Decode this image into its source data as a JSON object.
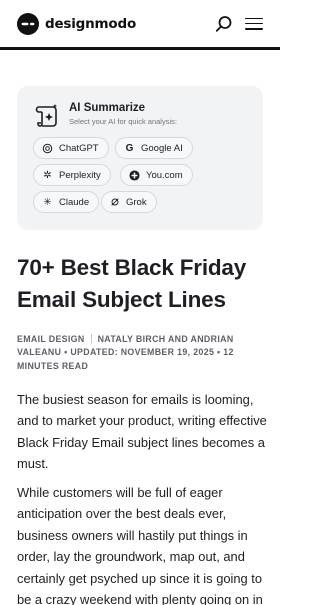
{
  "header": {
    "brand": "designmodo",
    "icons": {
      "logo": "designmodo-logo-icon",
      "search": "search-icon",
      "menu": "hamburger-menu-icon"
    }
  },
  "ai_summarize": {
    "title": "AI Summarize",
    "subtitle": "Select your AI for quick analysis:",
    "icon": "scroll-sparkle-icon",
    "options": [
      {
        "label": "ChatGPT",
        "icon": "chatgpt-icon"
      },
      {
        "label": "Google AI",
        "icon": "google-icon"
      },
      {
        "label": "Perplexity",
        "icon": "perplexity-icon"
      },
      {
        "label": "You.com",
        "icon": "you-com-icon"
      },
      {
        "label": "Claude",
        "icon": "claude-icon"
      },
      {
        "label": "Grok",
        "icon": "grok-icon"
      }
    ]
  },
  "article": {
    "title": "70+ Best Black Friday Email Subject Lines",
    "category": "Email Design",
    "byline": "Nataly Birch and Andrian Valeanu • Updated: November 19, 2025 • 12 minutes read",
    "paragraphs": [
      "The busiest season for emails is looming, and to market your product, writing effective Black Friday Email subject lines becomes a must.",
      "While customers will be full of eager anticipation over the best deals ever, business owners will hastily put things in order, lay the groundwork, map out, and certainly get psyched up since it is going to be a crazy weekend with plenty going on in both the real and digital world."
    ]
  },
  "colors": {
    "text": "#1e1f24",
    "muted": "#5d5f66",
    "card_bg": "#f2f3f5",
    "chip_border": "#d6d8de"
  }
}
